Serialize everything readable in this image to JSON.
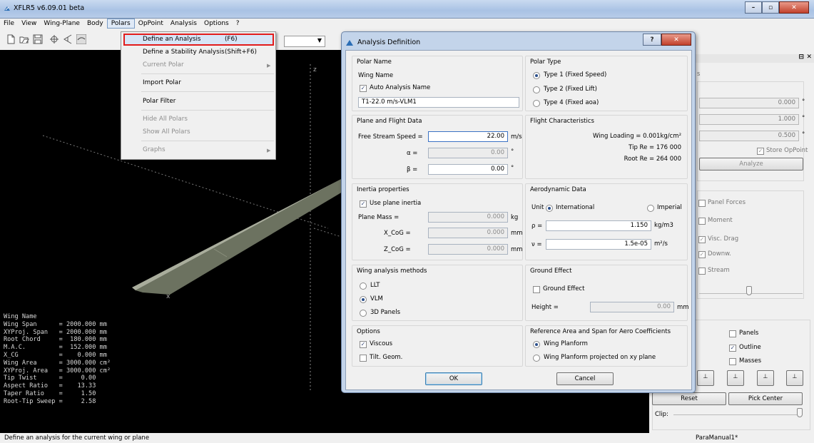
{
  "window": {
    "title": "XFLR5 v6.09.01 beta",
    "controls": {
      "minimize": "–",
      "maximize": "▫",
      "close": "✕"
    }
  },
  "menubar": {
    "items": [
      "File",
      "View",
      "Wing-Plane",
      "Body",
      "Polars",
      "OpPoint",
      "Analysis",
      "Options",
      "?"
    ]
  },
  "polars_menu": {
    "define_analysis": {
      "label": "Define an Analysis",
      "shortcut": "(F6)"
    },
    "define_stability": {
      "label": "Define a Stability Analysis",
      "shortcut": "(Shift+F6)"
    },
    "current_polar": "Current Polar",
    "import_polar": "Import Polar",
    "polar_filter": "Polar Filter",
    "hide_all": "Hide All Polars",
    "show_all": "Show All Polars",
    "graphs": "Graphs"
  },
  "viewport": {
    "axis_label": "z",
    "x_axis_label": "x",
    "properties": [
      {
        "name": "Wing Name",
        "value": ""
      },
      {
        "name": "Wing Span",
        "value": "= 2000.000 mm"
      },
      {
        "name": "XYProj. Span",
        "value": "= 2000.000 mm"
      },
      {
        "name": "Root Chord",
        "value": "=  180.000 mm"
      },
      {
        "name": "M.A.C.",
        "value": "=  152.000 mm"
      },
      {
        "name": "X_CG",
        "value": "=    0.000 mm"
      },
      {
        "name": "Wing Area",
        "value": "= 3000.000 cm²"
      },
      {
        "name": "XYProj. Area",
        "value": "= 3000.000 cm²"
      },
      {
        "name": "Tip Twist",
        "value": "=     0.00"
      },
      {
        "name": "Aspect Ratio",
        "value": "=    13.33"
      },
      {
        "name": "Taper Ratio",
        "value": "=     1.50"
      },
      {
        "name": "Root-Tip Sweep",
        "value": "=     2.58"
      }
    ]
  },
  "dialog": {
    "title": "Analysis Definition",
    "help_button": "?",
    "close_button": "✕",
    "polar_name": {
      "group_title": "Polar Name",
      "wing_name_label": "Wing Name",
      "auto_name_label": "Auto Analysis Name",
      "auto_name_checked": true,
      "name_value": "T1-22.0 m/s-VLM1"
    },
    "polar_type": {
      "group_title": "Polar Type",
      "options": [
        "Type 1 (Fixed Speed)",
        "Type 2 (Fixed Lift)",
        "Type 4 (Fixed aoa)"
      ],
      "selected": "Type 1 (Fixed Speed)"
    },
    "plane_flight": {
      "group_title": "Plane and Flight Data",
      "speed_label": "Free Stream Speed =",
      "speed_value": "22.00",
      "speed_unit": "m/s",
      "alpha_label": "α =",
      "alpha_value": "0.00",
      "alpha_unit": "°",
      "beta_label": "β =",
      "beta_value": "0.00",
      "beta_unit": "°"
    },
    "flight_characteristics": {
      "group_title": "Flight Characteristics",
      "wing_loading": "Wing Loading =  0.001kg/cm²",
      "tip_re": "Tip Re =  176 000",
      "root_re": "Root Re =  264 000"
    },
    "inertia": {
      "group_title": "Inertia properties",
      "use_plane_inertia": "Use plane inertia",
      "use_plane_inertia_checked": true,
      "mass_label": "Plane Mass =",
      "mass_value": "0.000",
      "mass_unit": "kg",
      "xcog_label": "X_CoG =",
      "xcog_value": "0.000",
      "xcog_unit": "mm",
      "zcog_label": "Z_CoG =",
      "zcog_value": "0.000",
      "zcog_unit": "mm"
    },
    "aero_data": {
      "group_title": "Aerodynamic Data",
      "unit_label": "Unit",
      "international": "International",
      "imperial": "Imperial",
      "selected": "International",
      "rho_label": "ρ =",
      "rho_value": "1.150",
      "rho_unit": "kg/m3",
      "nu_label": "ν =",
      "nu_value": "1.5e-05",
      "nu_unit": "m²/s"
    },
    "methods": {
      "group_title": "Wing analysis methods",
      "options": [
        "LLT",
        "VLM",
        "3D Panels"
      ],
      "selected": "VLM"
    },
    "ground_effect": {
      "group_title": "Ground Effect",
      "checkbox_label": "Ground Effect",
      "checked": false,
      "height_label": "Height =",
      "height_value": "0.00",
      "height_unit": "mm"
    },
    "options": {
      "group_title": "Options",
      "viscous": "Viscous",
      "viscous_checked": true,
      "tilt": "Tilt. Geom.",
      "tilt_checked": false
    },
    "reference": {
      "group_title": "Reference Area and Span for Aero Coefficients",
      "options": [
        "Wing Planform",
        "Wing Planform projected on xy plane"
      ],
      "selected": "Wing Planform"
    },
    "ok_label": "OK",
    "cancel_label": "Cancel"
  },
  "side_panel": {
    "title_tail": "s",
    "field1": "0.000",
    "field2": "1.000",
    "field3": "0.500",
    "unit_deg": "°",
    "store_oppoint": "Store OpPoint",
    "analyze": "Analyze",
    "panel_forces": "Panel Forces",
    "moment": "Moment",
    "visc_drag": "Visc. Drag",
    "downw": "Downw.",
    "stream": "Stream",
    "panels": "Panels",
    "outline": "Outline",
    "masses": "Masses",
    "reset": "Reset",
    "pick_center": "Pick Center",
    "clip": "Clip:"
  },
  "statusbar": {
    "message": "Define an analysis for the current wing or plane",
    "project": "ParaManual1*"
  },
  "colors": {
    "highlight_border": "#e21b1b",
    "dialog_frame": "#c3d4ea",
    "wing_surface": "#6c7260"
  }
}
